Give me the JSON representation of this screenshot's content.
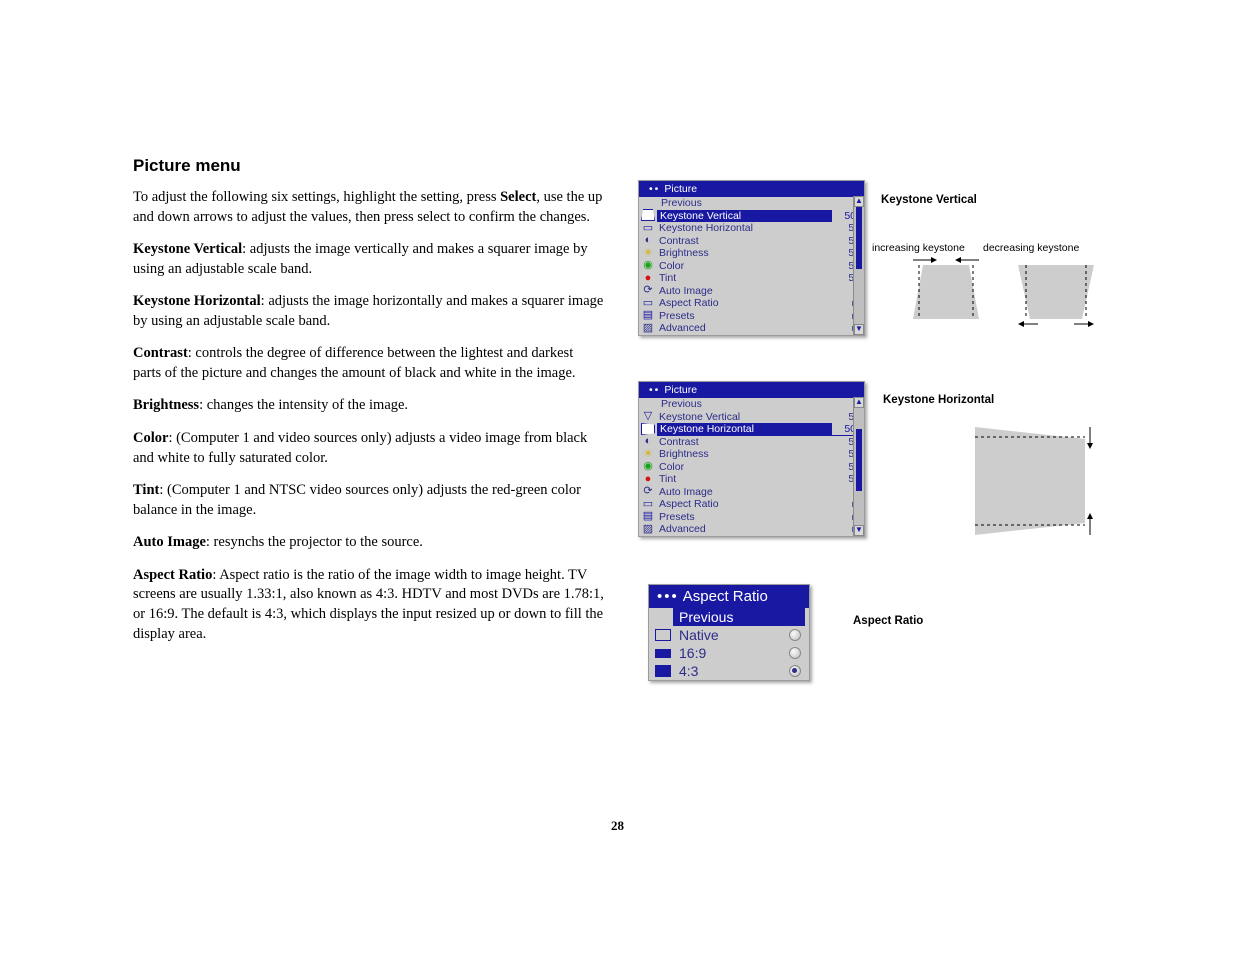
{
  "heading": "Picture menu",
  "intro_pre": "To adjust the following six settings, highlight the setting, press ",
  "intro_select": "Select",
  "intro_post": ", use the up and down arrows to adjust the values, then press select to confirm the changes.",
  "defs": {
    "kv_t": "Keystone Vertical",
    "kv_b": ": adjusts the image vertically and makes a squarer image by using an adjustable scale band.",
    "kh_t": "Keystone Horizontal",
    "kh_b": ": adjusts the image horizontally and makes a squarer image by using an adjustable scale band.",
    "co_t": "Contrast",
    "co_b": ": controls the degree of difference between the lightest and darkest parts of the picture and changes the amount of black and white in the image.",
    "br_t": "Brightness",
    "br_b": ": changes the intensity of the image.",
    "cl_t": "Color",
    "cl_b": ": (Computer 1 and video sources only) adjusts a video image from black and white to fully saturated color.",
    "ti_t": "Tint",
    "ti_b": ": (Computer 1 and NTSC video sources only) adjusts the red-green color balance in the image.",
    "ai_t": "Auto Image",
    "ai_b": ": resynchs the projector to the source.",
    "ar_t": "Aspect Ratio",
    "ar_b": ": Aspect ratio is the ratio of the image width to image height. TV screens are usually 1.33:1, also known as 4:3. HDTV and most DVDs are 1.78:1, or 16:9. The default is 4:3, which displays the input resized up or down to fill the display area."
  },
  "page_number": "28",
  "menu_title": "Picture",
  "menu_items": {
    "previous": "Previous",
    "kv": "Keystone Vertical",
    "kh": "Keystone Horizontal",
    "contrast": "Contrast",
    "brightness": "Brightness",
    "color": "Color",
    "tint": "Tint",
    "auto_image": "Auto Image",
    "aspect_ratio": "Aspect Ratio",
    "presets": "Presets",
    "advanced": "Advanced",
    "val50": "50"
  },
  "labels": {
    "kv": "Keystone Vertical",
    "kh": "Keystone Horizontal",
    "ar": "Aspect Ratio",
    "inc": "increasing keystone",
    "dec": "decreasing keystone"
  },
  "arrow_glyph": "►",
  "up_glyph": "▲",
  "down_glyph": "▼",
  "aspect_menu": {
    "title": "Aspect Ratio",
    "previous": "Previous",
    "native": "Native",
    "r169": "16:9",
    "r43": "4:3"
  }
}
